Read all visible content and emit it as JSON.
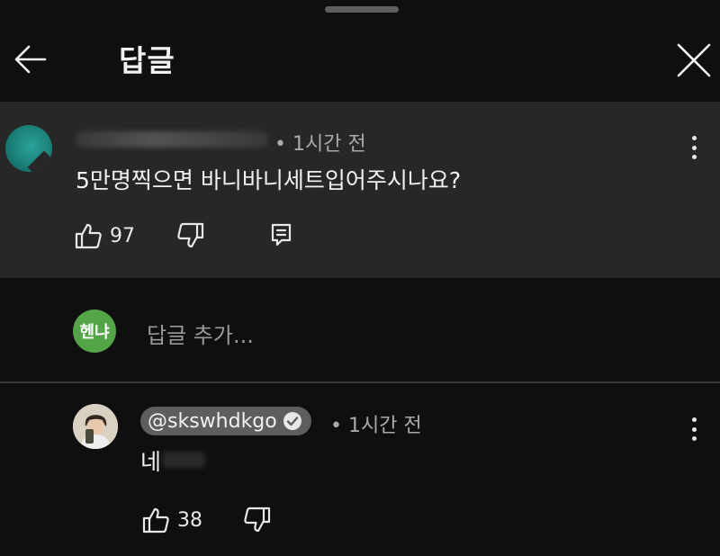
{
  "header": {
    "title": "답글"
  },
  "parent_comment": {
    "meta": "• 1시간 전",
    "text": "5만명찍으면 바니바니세트입어주시나요?",
    "likes": "97"
  },
  "add_reply": {
    "avatar_text": "헨냐",
    "placeholder": "답글 추가..."
  },
  "reply_comment": {
    "handle": "@skswhdkgo",
    "meta": "• 1시간 전",
    "text": "네",
    "likes": "38"
  },
  "colors": {
    "background": "#0f0f0f",
    "highlight_background": "#272727",
    "my_avatar": "#53a548",
    "handle_badge": "#5e5e5e"
  },
  "icons": {
    "back": "arrow-left-icon",
    "close": "close-icon",
    "more": "kebab-vertical-icon",
    "like": "thumbs-up-icon",
    "dislike": "thumbs-down-icon",
    "reply": "reply-comment-icon",
    "verified": "verified-check-icon"
  }
}
